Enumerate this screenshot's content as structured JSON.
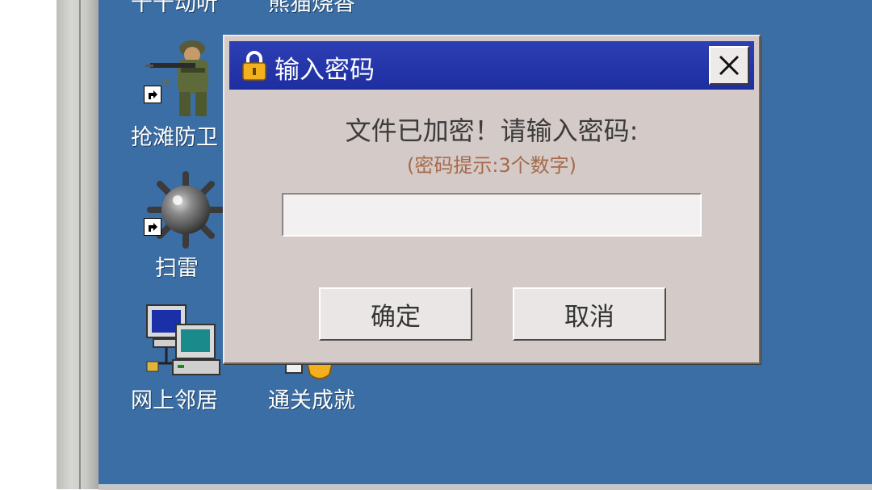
{
  "desktop": {
    "icons": [
      {
        "label": "千千动听"
      },
      {
        "label": "熊猫烧香"
      },
      {
        "label": "抢滩防卫"
      },
      {
        "label": "扫雷"
      },
      {
        "label": "网上邻居"
      },
      {
        "label": "通关成就"
      }
    ]
  },
  "dialog": {
    "title": "输入密码",
    "close_icon": "close-icon",
    "prompt": "文件已加密！请输入密码:",
    "hint": "(密码提示:3个数字)",
    "password_value": "",
    "ok_label": "确定",
    "cancel_label": "取消"
  },
  "colors": {
    "desktop_bg": "#3a6ea5",
    "titlebar": "#1d2ea0",
    "dialog_bg": "#d4cac8",
    "hint_text": "#a66a4a"
  }
}
